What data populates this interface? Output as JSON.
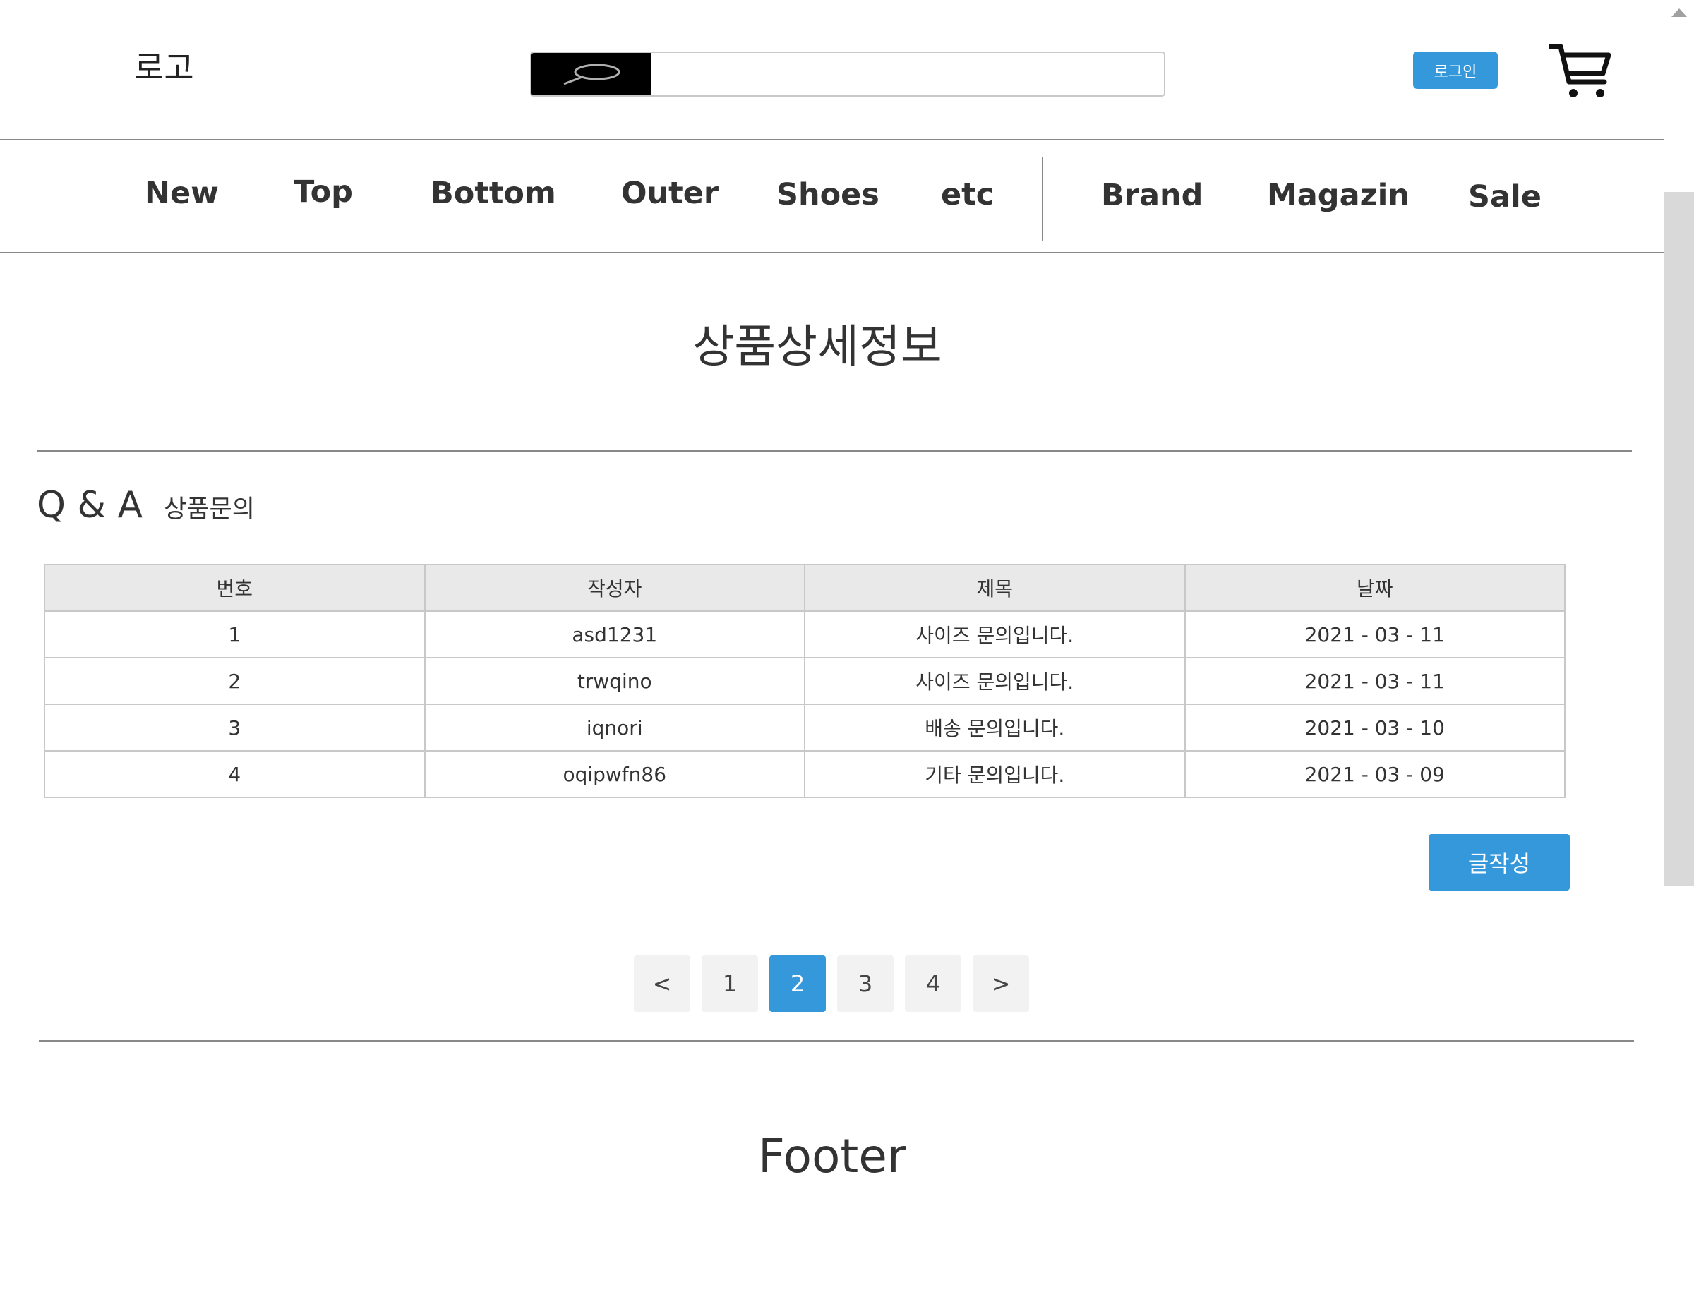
{
  "header": {
    "logo": "로고",
    "search": {
      "placeholder": "",
      "value": "",
      "icon": "search-icon"
    },
    "login_label": "로그인",
    "cart_icon": "cart-icon"
  },
  "nav": {
    "items": [
      "New",
      "Top",
      "Bottom",
      "Outer",
      "Shoes",
      "etc"
    ],
    "extra_items": [
      "Brand",
      "Magazin",
      "Sale"
    ]
  },
  "main": {
    "title": "상품상세정보",
    "qa": {
      "title": "Q & A",
      "subtitle": "상품문의",
      "columns": [
        "번호",
        "작성자",
        "제목",
        "날짜"
      ],
      "rows": [
        [
          "1",
          "asd1231",
          "사이즈 문의입니다.",
          "2021 - 03 - 11"
        ],
        [
          "2",
          "trwqino",
          "사이즈 문의입니다.",
          "2021 - 03 - 11"
        ],
        [
          "3",
          "iqnori",
          "배송 문의입니다.",
          "2021 - 03 - 10"
        ],
        [
          "4",
          "oqipwfn86",
          "기타 문의입니다.",
          "2021 - 03 - 09"
        ]
      ],
      "write_label": "글작성"
    },
    "pagination": {
      "prev": "<",
      "pages": [
        "1",
        "2",
        "3",
        "4"
      ],
      "current": "2",
      "next": ">"
    }
  },
  "footer": {
    "text": "Footer"
  },
  "colors": {
    "accent": "#3498db",
    "border": "#888888",
    "table_header_bg": "#e9e9e9"
  }
}
